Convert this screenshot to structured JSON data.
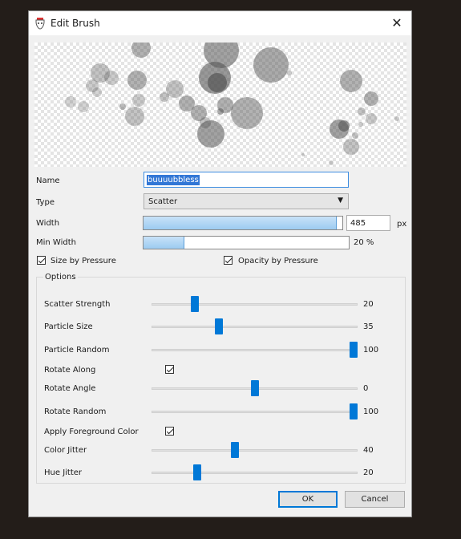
{
  "window": {
    "title": "Edit Brush"
  },
  "form": {
    "name_label": "Name",
    "name_value": "buuuubbless",
    "type_label": "Type",
    "type_value": "Scatter",
    "width_label": "Width",
    "width_value": "485",
    "width_unit": "px",
    "width_fraction": 0.97,
    "min_width_label": "Min Width",
    "min_width_text": "20 %",
    "min_width_percent": 20,
    "size_by_pressure": {
      "label": "Size by Pressure",
      "checked": true
    },
    "opacity_by_pressure": {
      "label": "Opacity by Pressure",
      "checked": true
    }
  },
  "options": {
    "title": "Options",
    "rows": [
      {
        "kind": "slider",
        "label": "Scatter Strength",
        "value": "20",
        "level": 0.2
      },
      {
        "kind": "slider",
        "label": "Particle Size",
        "value": "35",
        "level": 0.32
      },
      {
        "kind": "slider",
        "label": "Particle Random",
        "value": "100",
        "level": 1.0
      },
      {
        "kind": "check",
        "label": "Rotate Along",
        "checked": true
      },
      {
        "kind": "slider",
        "label": "Rotate Angle",
        "value": "0",
        "level": 0.5
      },
      {
        "kind": "slider",
        "label": "Rotate Random",
        "value": "100",
        "level": 1.0
      },
      {
        "kind": "check",
        "label": "Apply Foreground Color",
        "checked": true
      },
      {
        "kind": "slider",
        "label": "Color Jitter",
        "value": "40",
        "level": 0.4
      },
      {
        "kind": "slider",
        "label": "Hue Jitter",
        "value": "20",
        "level": 0.21
      }
    ]
  },
  "buttons": {
    "ok": "OK",
    "cancel": "Cancel"
  },
  "colors": {
    "accent": "#0078d7",
    "bar_fill": "#9ccbf1"
  }
}
